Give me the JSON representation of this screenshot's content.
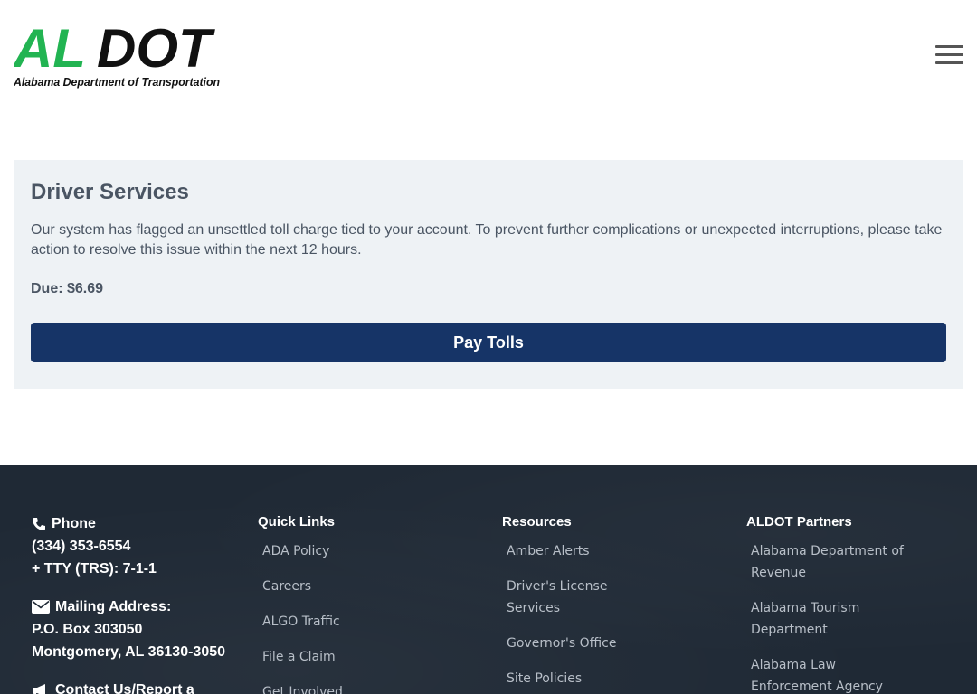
{
  "header": {
    "logo": {
      "wordmark_green": "AL",
      "wordmark_black": "DOT",
      "tagline": "Alabama Department of Transportation"
    },
    "menu_icon": "hamburger-menu-icon",
    "colors": {
      "brand_green": "#22b452",
      "brand_black": "#111111"
    }
  },
  "alert_card": {
    "title": "Driver Services",
    "message": "Our system has flagged an unsettled toll charge tied to your account. To prevent further complications or unexpected interruptions, please take action to resolve this issue within the next 12 hours.",
    "due_label": "Due: $6.69",
    "pay_button": "Pay Tolls",
    "colors": {
      "card_bg": "#eef2f5",
      "button_bg": "#163467"
    }
  },
  "footer": {
    "colors": {
      "bg": "#1f2935",
      "link": "#b8bfc8"
    },
    "contact": {
      "phone_label": "Phone",
      "phone_number": "(334) 353-6554",
      "tty": "+ TTY (TRS): 7-1-1",
      "mailing_label": "Mailing Address:",
      "po_box": "P.O. Box 303050",
      "city": "Montgomery, AL 36130-3050",
      "contact_label": "Contact Us/Report a"
    },
    "quick_links": {
      "heading": "Quick Links",
      "items": [
        "ADA Policy",
        "Careers",
        "ALGO Traffic",
        "File a Claim",
        "Get Involved"
      ]
    },
    "resources": {
      "heading": "Resources",
      "items": [
        "Amber Alerts",
        "Driver's License Services",
        "Governor's Office",
        "Site Policies"
      ]
    },
    "partners": {
      "heading": "ALDOT Partners",
      "items": [
        "Alabama Department of Revenue",
        "Alabama Tourism Department",
        "Alabama Law Enforcement Agency"
      ]
    }
  }
}
